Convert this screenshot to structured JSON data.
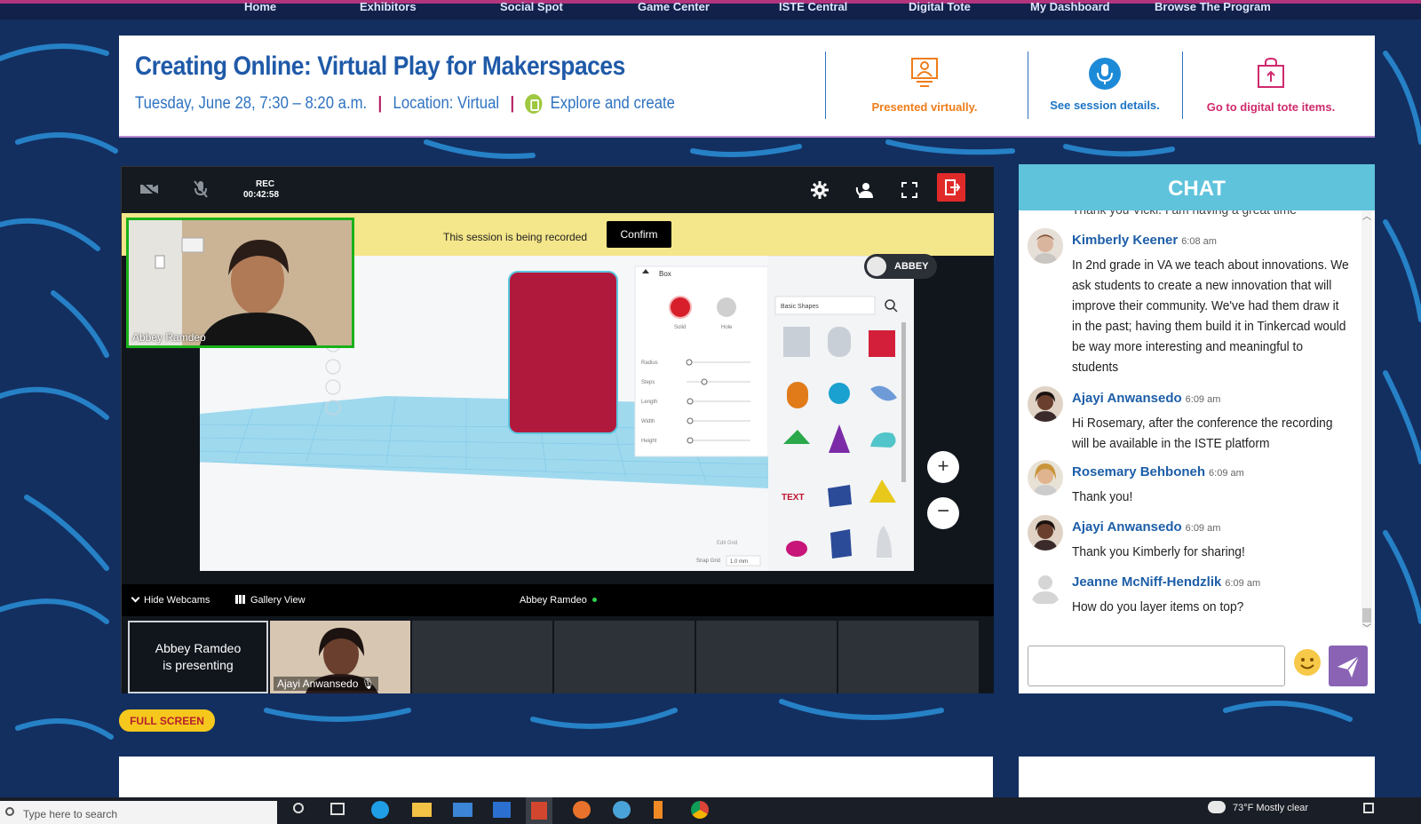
{
  "nav": {
    "items": [
      "Home",
      "Exhibitors",
      "Social Spot",
      "Game Center",
      "ISTE Central",
      "Digital Tote",
      "My Dashboard",
      "Browse The Program"
    ]
  },
  "session": {
    "title": "Creating Online: Virtual Play for Makerspaces",
    "datetime": "Tuesday, June 28, 7:30 – 8:20 a.m.",
    "location": "Location: Virtual",
    "track": "Explore and create"
  },
  "actions": {
    "presented": "Presented virtually.",
    "details": "See session details.",
    "tote": "Go to digital tote items."
  },
  "video": {
    "rec_label": "REC",
    "rec_time": "00:42:58",
    "banner_text": "This session is being recorded",
    "confirm_label": "Confirm",
    "presenter_cam_name": "Abbey Ramdeo",
    "share_user_tag": "ABBEY",
    "hide_webcams": "Hide Webcams",
    "gallery_view": "Gallery View",
    "active_speaker": "Abbey Ramdeo",
    "presenting_text": "Abbey Ramdeo is presenting",
    "thumb_name": "Ajayi Anwansedo"
  },
  "tinkercad": {
    "shape_name": "Box",
    "solid_label": "Solid",
    "hole_label": "Hole",
    "params": [
      "Radius",
      "Steps",
      "Length",
      "Width",
      "Height"
    ],
    "library_label": "Basic Shapes",
    "edit_grid": "Edit Grid",
    "snap_grid": "Snap Grid",
    "snap_value": "1.0 mm"
  },
  "chat": {
    "title": "CHAT",
    "partial_top": "Thank you Vicki. I am having a great time",
    "messages": [
      {
        "name": "Kimberly Keener",
        "time": "6:08 am",
        "text": "In 2nd grade in VA we teach about innovations. We ask students to create a new innovation that will improve their community. We've had them draw it in the past; having them build it in Tinkercad would be way more interesting and meaningful to students"
      },
      {
        "name": "Ajayi Anwansedo",
        "time": "6:09 am",
        "text": "Hi Rosemary, after the conference the recording will be available in the ISTE platform"
      },
      {
        "name": "Rosemary Behboneh",
        "time": "6:09 am",
        "text": "Thank you!"
      },
      {
        "name": "Ajayi Anwansedo",
        "time": "6:09 am",
        "text": "Thank you Kimberly for sharing!"
      },
      {
        "name": "Jeanne McNiff-Hendzlik",
        "time": "6:09 am",
        "text": "How do you layer items on top?"
      }
    ],
    "input_placeholder": ""
  },
  "fullscreen_label": "FULL SCREEN",
  "taskbar": {
    "search_placeholder": "Type here to search",
    "weather": "73°F  Mostly clear"
  },
  "colors": {
    "accent_blue": "#1f5aa8",
    "chat_header": "#5fc3dc",
    "send": "#8a63b5",
    "fullscreen": "#f6c81d"
  }
}
